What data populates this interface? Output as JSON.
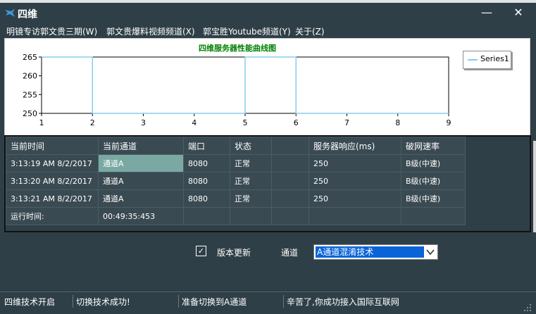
{
  "window": {
    "title": "四维",
    "minimize_label": "—",
    "close_label": "✕"
  },
  "menu": [
    {
      "label": "明镜专访郭文贵三期(W)"
    },
    {
      "label": "郭文贵爆料视频频道(X)"
    },
    {
      "label": "郭宝胜Youtube频道(Y)"
    },
    {
      "label": "关于(Z)"
    }
  ],
  "chart_data": {
    "type": "line",
    "title": "四维服务器性能曲线图",
    "xlabel": "",
    "ylabel": "",
    "xlim": [
      1,
      9
    ],
    "ylim": [
      250,
      265
    ],
    "xticks": [
      "1",
      "2",
      "3",
      "4",
      "5",
      "6",
      "7",
      "8",
      "9"
    ],
    "yticks": [
      "265",
      "260",
      "255",
      "250"
    ],
    "legend_position": "right",
    "grid": false,
    "series": [
      {
        "name": "Series1",
        "color": "#87ceeb",
        "points": [
          [
            1,
            265
          ],
          [
            2,
            265
          ],
          [
            2,
            250
          ],
          [
            5,
            250
          ],
          [
            5,
            265
          ],
          [
            6,
            265
          ],
          [
            6,
            250
          ],
          [
            9,
            250
          ]
        ]
      }
    ]
  },
  "table": {
    "headers": [
      "当前时间",
      "当前通道",
      "端口",
      "状态",
      "",
      "服务器响应(ms)",
      "破网速率"
    ],
    "rows": [
      [
        "3:13:19 AM 8/2/2017",
        "通道A",
        "8080",
        "正常",
        "",
        "250",
        "B级(中速)"
      ],
      [
        "3:13:20 AM 8/2/2017",
        "通道A",
        "8080",
        "正常",
        "",
        "250",
        "B级(中速)"
      ],
      [
        "3:13:21 AM 8/2/2017",
        "通道A",
        "8080",
        "正常",
        "",
        "250",
        "B级(中速)"
      ],
      [
        "运行时间:",
        "00:49:35:453",
        "",
        "",
        "",
        "",
        ""
      ]
    ]
  },
  "controls": {
    "update_checkbox_checked": true,
    "checkmark": "✓",
    "update_label": "版本更新",
    "channel_label": "通道",
    "channel_selected": "A通道混淆技术"
  },
  "status": [
    {
      "text": "四维技术开启"
    },
    {
      "text": "切换技术成功!"
    },
    {
      "text": "准备切换到A通道"
    },
    {
      "text": "辛苦了,你成功接入国际互联网"
    }
  ],
  "colors": {
    "background": "#2f3f47",
    "series_line": "#87ceeb",
    "chart_title": "#008000",
    "selected_cell": "#7aa9a3",
    "select_highlight": "#0a64d8"
  }
}
